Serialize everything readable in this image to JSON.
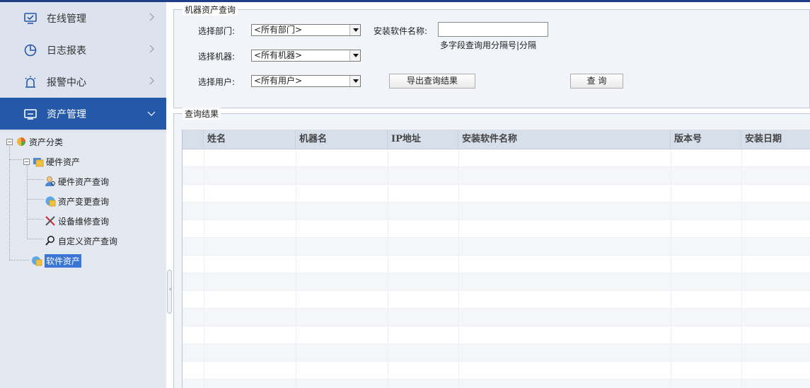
{
  "sidebar": {
    "nav": [
      {
        "label": "在线管理",
        "icon": "monitor-check-icon",
        "active": false
      },
      {
        "label": "日志报表",
        "icon": "pie-chart-icon",
        "active": false
      },
      {
        "label": "报警中心",
        "icon": "alarm-light-icon",
        "active": false
      },
      {
        "label": "资产管理",
        "icon": "screen-icon",
        "active": true
      }
    ],
    "tree": {
      "root": "资产分类",
      "hardware": "硬件资产",
      "hardware_children": [
        "硬件资产查询",
        "资产变更查询",
        "设备维修查询",
        "自定义资产查询"
      ],
      "software": "软件资产"
    }
  },
  "query": {
    "legend": "机器资产查询",
    "dept_label": "选择部门:",
    "dept_value": "<所有部门>",
    "software_label": "安装软件名称:",
    "software_value": "",
    "software_hint": "多字段查询用分隔号|分隔",
    "machine_label": "选择机器:",
    "machine_value": "<所有机器>",
    "user_label": "选择用户:",
    "user_value": "<所有用户>",
    "export_button": "导出查询结果",
    "query_button": "查 询"
  },
  "results": {
    "legend": "查询结果",
    "columns": [
      "姓名",
      "机器名",
      "IP地址",
      "安装软件名称",
      "版本号",
      "安装日期"
    ],
    "rows": []
  }
}
